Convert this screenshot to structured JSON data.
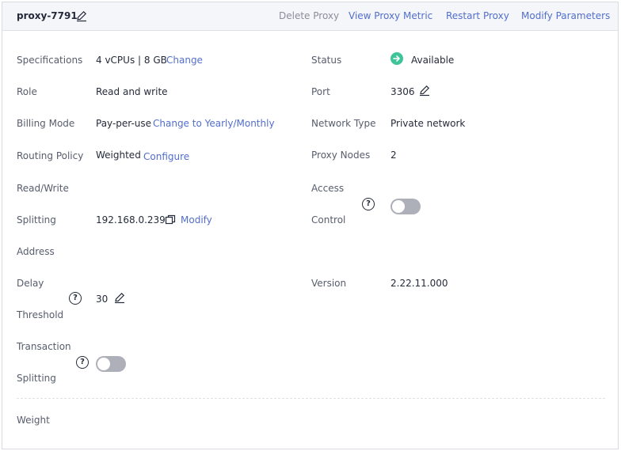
{
  "header": {
    "proxy_name": "proxy-7791",
    "actions": {
      "delete": "Delete Proxy",
      "metric": "View Proxy Metric",
      "restart": "Restart Proxy",
      "modify": "Modify Parameters"
    }
  },
  "left": {
    "specifications": {
      "label": "Specifications",
      "value": "4 vCPUs | 8 GB",
      "link": "Change"
    },
    "role": {
      "label": "Role",
      "value": "Read and write"
    },
    "billing": {
      "label": "Billing Mode",
      "value": "Pay-per-use",
      "link": "Change to Yearly/Monthly"
    },
    "routing": {
      "label": "Routing Policy",
      "value": "Weighted",
      "link": "Configure"
    },
    "rw_split": {
      "label_1": "Read/Write",
      "label_2": "Splitting",
      "label_3": "Address",
      "value": "192.168.0.239",
      "link": "Modify"
    },
    "delay": {
      "label_1": "Delay",
      "label_2": "Threshold",
      "value": "30"
    },
    "transaction": {
      "label_1": "Transaction",
      "label_2": "Splitting",
      "enabled": false
    },
    "weight": {
      "label": "Weight"
    }
  },
  "right": {
    "status": {
      "label": "Status",
      "value": "Available",
      "color": "#3ec498"
    },
    "port": {
      "label": "Port",
      "value": "3306"
    },
    "network": {
      "label": "Network Type",
      "value": "Private network"
    },
    "nodes": {
      "label": "Proxy Nodes",
      "value": "2"
    },
    "access": {
      "label_1": "Access",
      "label_2": "Control",
      "enabled": false
    },
    "version": {
      "label": "Version",
      "value": "2.22.11.000"
    }
  },
  "help_glyph": "?"
}
